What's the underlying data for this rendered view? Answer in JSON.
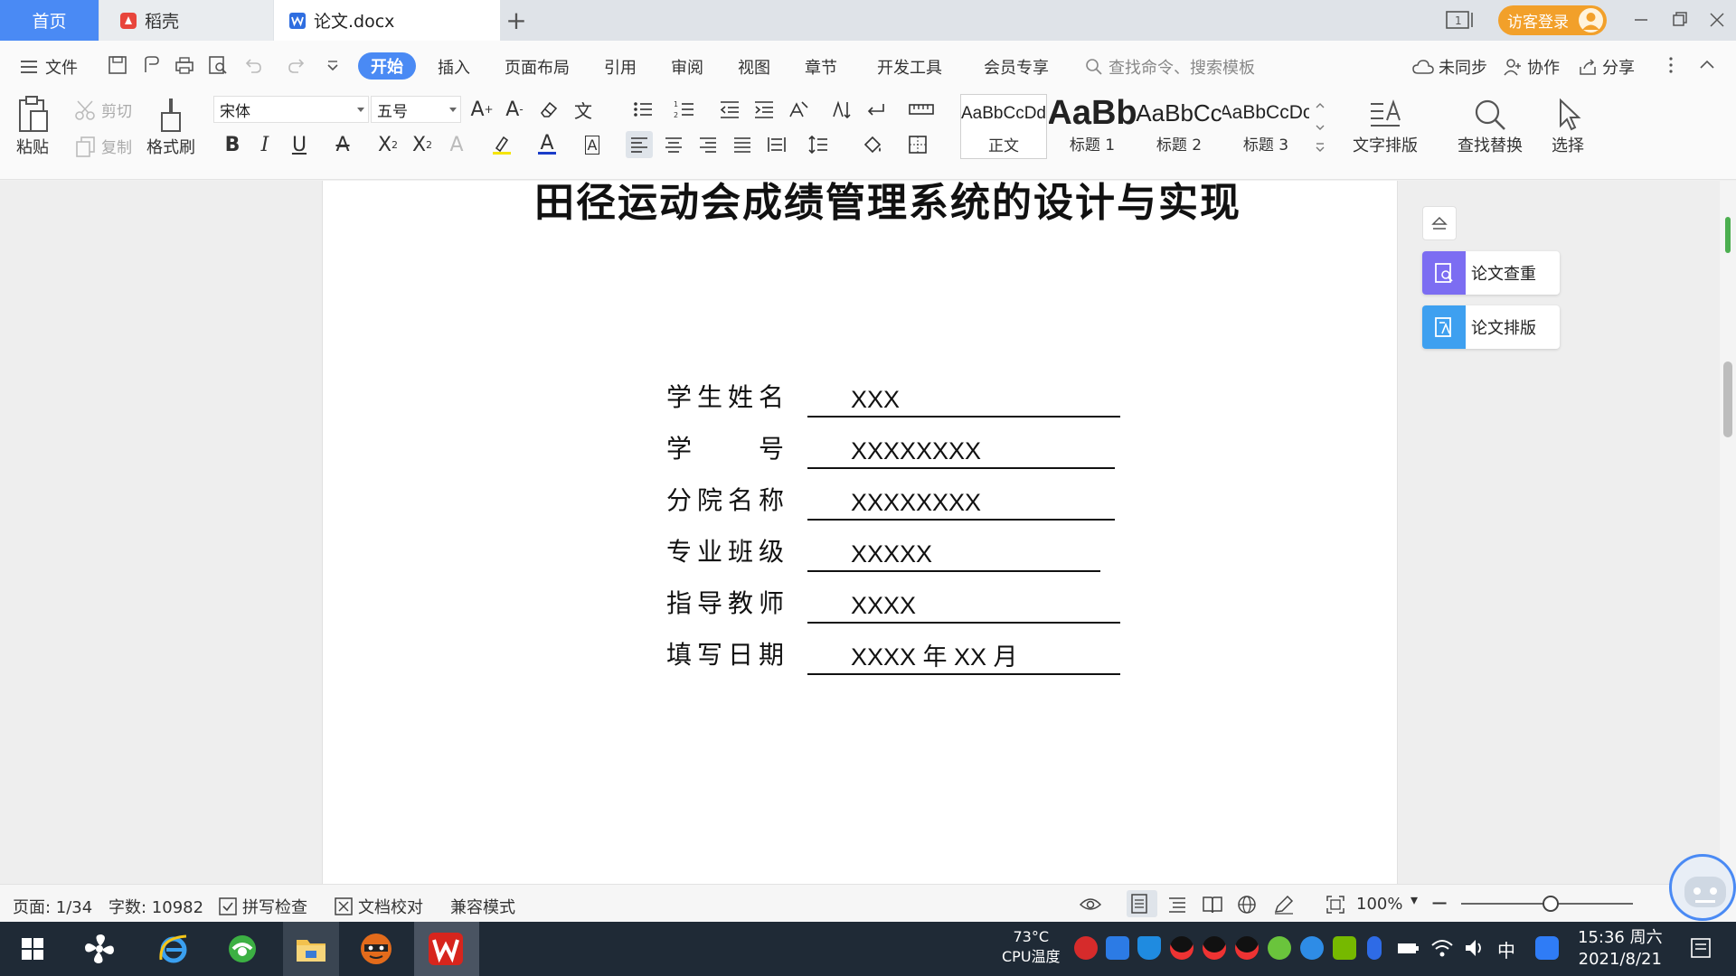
{
  "titlebar": {
    "tabs": [
      {
        "label": "首页"
      },
      {
        "label": "稻壳"
      },
      {
        "label": "论文.docx"
      }
    ],
    "visitor_login": "访客登录",
    "colors": {
      "active_tab": "#4a8af4",
      "visitor": "#f2a02a"
    }
  },
  "menubar": {
    "file": "文件",
    "tabs": [
      "开始",
      "插入",
      "页面布局",
      "引用",
      "审阅",
      "视图",
      "章节",
      "开发工具",
      "会员专享"
    ],
    "search_placeholder": "查找命令、搜索模板",
    "unsynced": "未同步",
    "collaborate": "协作",
    "share": "分享"
  },
  "ribbon": {
    "paste": "粘贴",
    "cut": "剪切",
    "copy": "复制",
    "format_painter": "格式刷",
    "font_name": "宋体",
    "font_size": "五号",
    "styles": [
      {
        "sample": "AaBbCcDd",
        "label": "正文"
      },
      {
        "sample": "AaBb",
        "label": "标题 1"
      },
      {
        "sample": "AaBbCc",
        "label": "标题 2"
      },
      {
        "sample": "AaBbCcDc",
        "label": "标题 3"
      }
    ],
    "text_layout": "文字排版",
    "find_replace": "查找替换",
    "select": "选择"
  },
  "document": {
    "title": "田径运动会成绩管理系统的设计与实现",
    "fields": [
      {
        "label": "学生姓名",
        "value": "XXX"
      },
      {
        "label": "学　　号",
        "value": "XXXXXXXX"
      },
      {
        "label": "分院名称",
        "value": "XXXXXXXX"
      },
      {
        "label": "专业班级",
        "value": "XXXXX"
      },
      {
        "label": "指导教师",
        "value": "XXXX"
      },
      {
        "label": "填写日期",
        "value": "XXXX 年 XX 月"
      }
    ]
  },
  "side_panel": {
    "check": "论文查重",
    "format": "论文排版"
  },
  "statusbar": {
    "page": "页面: 1/34",
    "words": "字数: 10982",
    "spell_check": "拼写检查",
    "doc_proof": "文档校对",
    "compat_mode": "兼容模式",
    "zoom": "100%"
  },
  "taskbar": {
    "cpu_temp": "73°C",
    "cpu_label": "CPU温度",
    "ime": "中",
    "time": "15:36 周六",
    "date": "2021/8/21"
  }
}
